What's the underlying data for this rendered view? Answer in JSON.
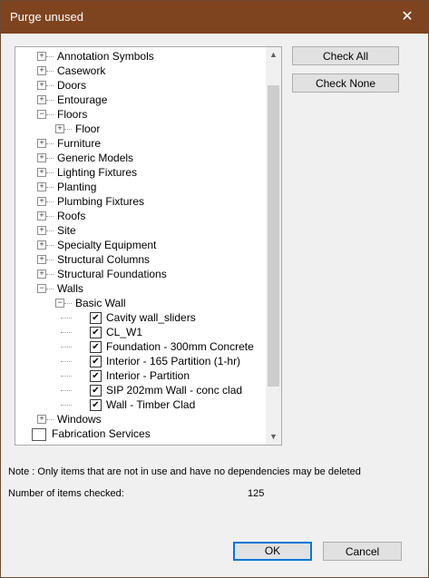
{
  "window": {
    "title": "Purge unused",
    "close_glyph": "✕"
  },
  "tree": {
    "items": [
      {
        "label": "Annotation Symbols",
        "level": 1,
        "expander": "+",
        "checkbox": false
      },
      {
        "label": "Casework",
        "level": 1,
        "expander": "+",
        "checkbox": false
      },
      {
        "label": "Doors",
        "level": 1,
        "expander": "+",
        "checkbox": false
      },
      {
        "label": "Entourage",
        "level": 1,
        "expander": "+",
        "checkbox": false
      },
      {
        "label": "Floors",
        "level": 1,
        "expander": "−",
        "checkbox": false
      },
      {
        "label": "Floor",
        "level": 2,
        "expander": "+",
        "checkbox": false
      },
      {
        "label": "Furniture",
        "level": 1,
        "expander": "+",
        "checkbox": false
      },
      {
        "label": "Generic Models",
        "level": 1,
        "expander": "+",
        "checkbox": false
      },
      {
        "label": "Lighting Fixtures",
        "level": 1,
        "expander": "+",
        "checkbox": false
      },
      {
        "label": "Planting",
        "level": 1,
        "expander": "+",
        "checkbox": false
      },
      {
        "label": "Plumbing Fixtures",
        "level": 1,
        "expander": "+",
        "checkbox": false
      },
      {
        "label": "Roofs",
        "level": 1,
        "expander": "+",
        "checkbox": false
      },
      {
        "label": "Site",
        "level": 1,
        "expander": "+",
        "checkbox": false
      },
      {
        "label": "Specialty Equipment",
        "level": 1,
        "expander": "+",
        "checkbox": false
      },
      {
        "label": "Structural Columns",
        "level": 1,
        "expander": "+",
        "checkbox": false
      },
      {
        "label": "Structural Foundations",
        "level": 1,
        "expander": "+",
        "checkbox": false
      },
      {
        "label": "Walls",
        "level": 1,
        "expander": "−",
        "checkbox": false
      },
      {
        "label": "Basic Wall",
        "level": 2,
        "expander": "−",
        "checkbox": false
      },
      {
        "label": "Cavity wall_sliders",
        "level": 3,
        "expander": "",
        "checkbox": true,
        "checked": true
      },
      {
        "label": "CL_W1",
        "level": 3,
        "expander": "",
        "checkbox": true,
        "checked": true
      },
      {
        "label": "Foundation - 300mm Concrete",
        "level": 3,
        "expander": "",
        "checkbox": true,
        "checked": true
      },
      {
        "label": "Interior - 165 Partition (1-hr)",
        "level": 3,
        "expander": "",
        "checkbox": true,
        "checked": true
      },
      {
        "label": "Interior - Partition",
        "level": 3,
        "expander": "",
        "checkbox": true,
        "checked": true
      },
      {
        "label": "SIP 202mm Wall - conc clad",
        "level": 3,
        "expander": "",
        "checkbox": true,
        "checked": true
      },
      {
        "label": "Wall - Timber Clad",
        "level": 3,
        "expander": "",
        "checkbox": true,
        "checked": true
      },
      {
        "label": "Windows",
        "level": 1,
        "expander": "+",
        "checkbox": false
      },
      {
        "label": "Fabrication Services",
        "level": 0,
        "expander": "",
        "checkbox": false,
        "icon": "fabrication-icon"
      }
    ],
    "check_glyph": "✔",
    "scroll_up_glyph": "▲",
    "scroll_down_glyph": "▼"
  },
  "buttons": {
    "check_all": "Check All",
    "check_none": "Check None",
    "ok": "OK",
    "cancel": "Cancel"
  },
  "footer": {
    "note": "Note : Only items that are not in use and have no dependencies may be deleted",
    "count_label": "Number of items checked:",
    "count_value": "125"
  },
  "colors": {
    "titlebar": "#7e4420",
    "primary_border": "#0078d7"
  }
}
